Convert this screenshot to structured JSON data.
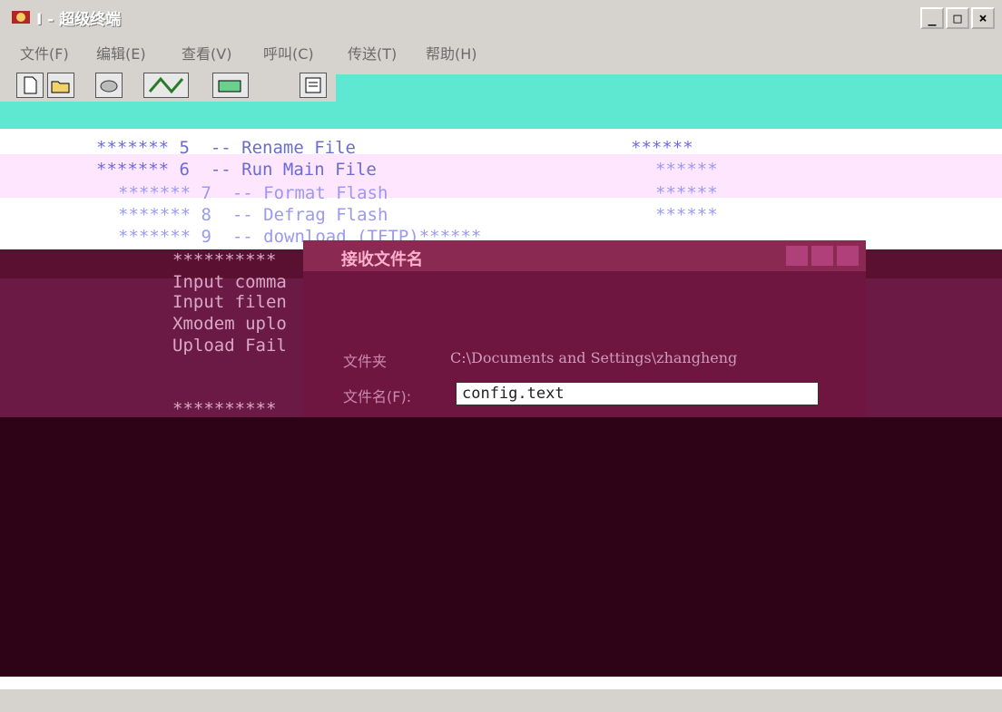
{
  "window": {
    "title": "I - 超级终端",
    "minimize_glyph": "_",
    "maximize_glyph": "□",
    "close_glyph": "×"
  },
  "menu": [
    "文件(F)",
    "编辑(E)",
    "查看(V)",
    "呼叫(C)",
    "传送(T)",
    "帮助(H)"
  ],
  "toolbar": {
    "icons": [
      "new-file-icon",
      "open-folder-icon",
      "disconnect-icon",
      "call-icon",
      "send-file-icon",
      "properties-icon"
    ]
  },
  "terminal": {
    "lines": [
      "******* 5  -- Rename File",
      "******* 6  -- Run Main File",
      "******* 7  -- Format Flash",
      "******* 8  -- Defrag Flash",
      "******* 9  -- download (TFTP)******",
      "**********",
      "Input comma",
      "Input filen",
      "Xmodem uplo",
      "Upload Fail",
      "**********",
      "**********"
    ],
    "right_stars": [
      "******",
      "******",
      "******",
      "******",
      "******"
    ],
    "colors": {
      "blue_text": "#6b6bd6",
      "red_text": "#7a1a1a",
      "background": "#ffffff"
    }
  },
  "dialog": {
    "title": "接收文件名",
    "folder_label": "文件夹",
    "folder_path": "C:\\Documents and Settings\\zhangheng",
    "filename_label": "文件名(F):",
    "filename_value": "config.text"
  },
  "colors": {
    "titlebar": "#d6d3ce",
    "accent_cyan": "#5ee8d2",
    "dialog_bg": "#6e1640",
    "dark_overlay": "#2e0217"
  }
}
